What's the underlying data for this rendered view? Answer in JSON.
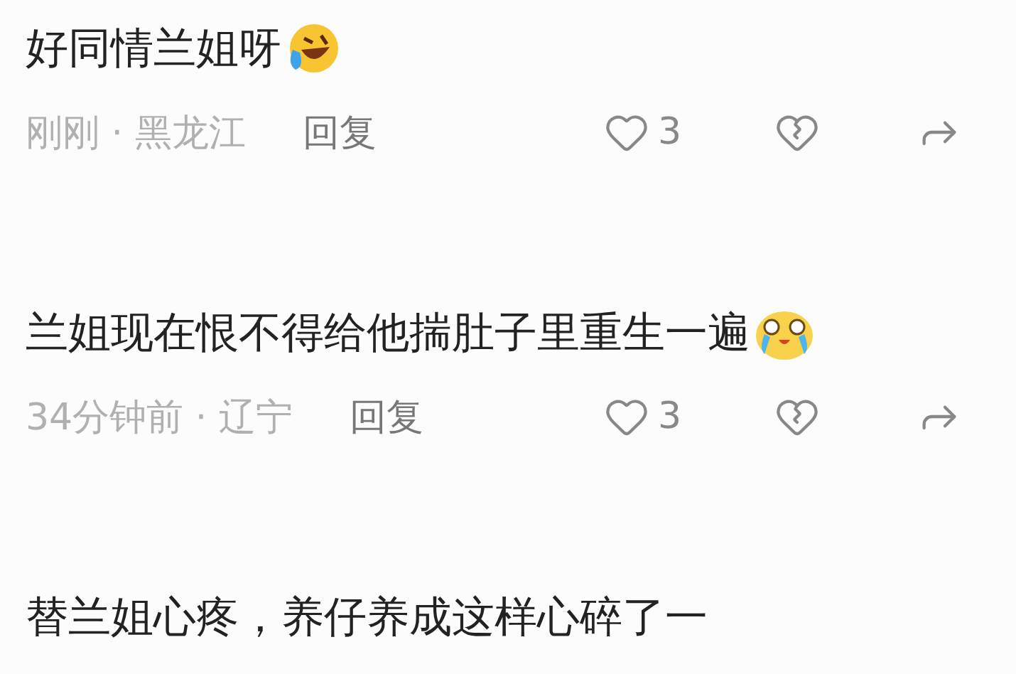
{
  "comments": [
    {
      "text": "好同情兰姐呀",
      "emoji": {
        "kind": "laugh-cry"
      },
      "meta": "刚刚 · 黑龙江",
      "reply": "回复",
      "likes": "3"
    },
    {
      "text": "兰姐现在恨不得给他揣肚子里重生一遍",
      "emoji": {
        "kind": "cry"
      },
      "meta": "34分钟前 · 辽宁",
      "reply": "回复",
      "likes": "3"
    },
    {
      "text": "替兰姐心疼，养仔养成这样心碎了一"
    }
  ]
}
